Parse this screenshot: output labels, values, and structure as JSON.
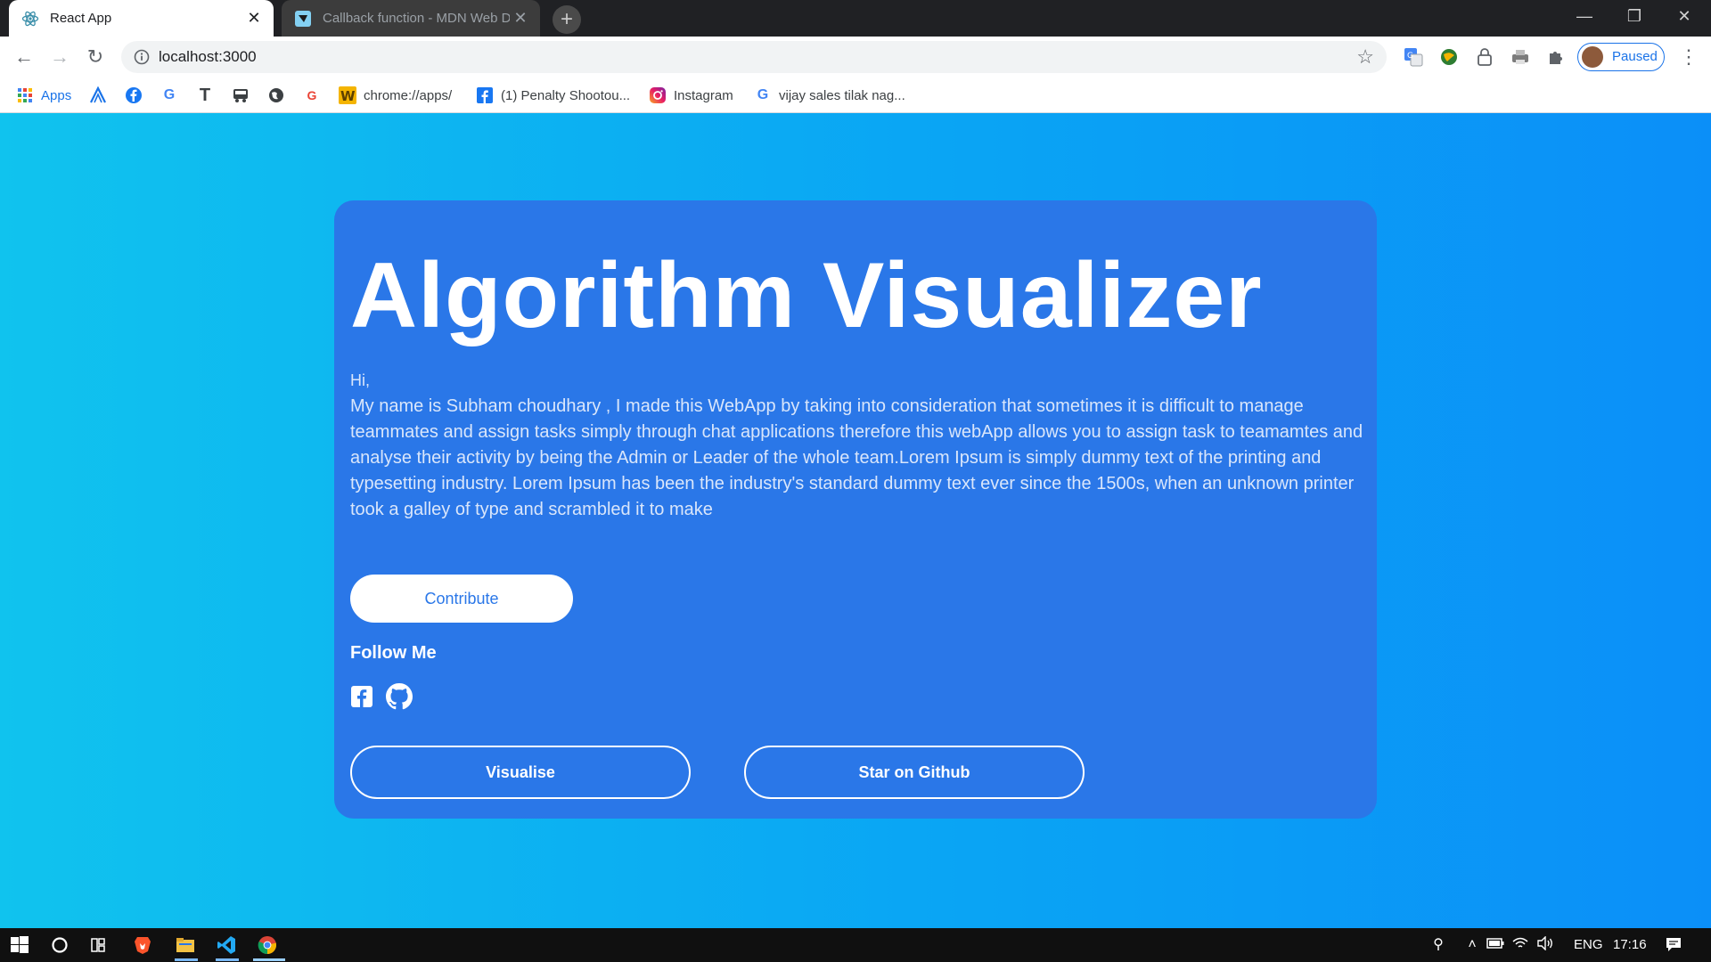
{
  "browser": {
    "tabs": [
      {
        "title": "React App",
        "favicon": "react-icon",
        "active": true
      },
      {
        "title": "Callback function - MDN Web Docs",
        "favicon": "mdn-icon",
        "active": false
      }
    ],
    "new_tab_label": "+",
    "window_controls": {
      "minimize": "—",
      "maximize": "❐",
      "close": "✕"
    },
    "address": "localhost:3000",
    "profile_label": "Paused",
    "extensions": [
      "translate-icon",
      "globe-extension-icon",
      "lock-extension-icon",
      "printer-icon",
      "puzzle-icon"
    ]
  },
  "bookmarks": [
    {
      "label": "Apps",
      "icon": "apps-grid-icon"
    },
    {
      "label": "",
      "icon": "a-logo-icon"
    },
    {
      "label": "",
      "icon": "facebook-icon"
    },
    {
      "label": "",
      "icon": "google-icon"
    },
    {
      "label": "",
      "icon": "tz-icon"
    },
    {
      "label": "",
      "icon": "bus-icon"
    },
    {
      "label": "",
      "icon": "globe-icon"
    },
    {
      "label": "",
      "icon": "google-small-icon"
    },
    {
      "label": "chrome://apps/",
      "icon": "w-icon"
    },
    {
      "label": "(1) Penalty Shootou...",
      "icon": "facebook-icon"
    },
    {
      "label": "Instagram",
      "icon": "instagram-icon"
    },
    {
      "label": "vijay sales tilak nag...",
      "icon": "google-icon"
    }
  ],
  "hero": {
    "title": "Algorithm Visualizer",
    "greeting": "Hi,",
    "bio": "My name is Subham choudhary , I made this WebApp by taking into consideration that sometimes it is difficult to manage teammates and assign tasks simply through chat applications therefore this webApp allows you to assign task to teamamtes and analyse their activity by being the Admin or Leader of the whole team.Lorem Ipsum is simply dummy text of the printing and typesetting industry. Lorem Ipsum has been the industry's standard dummy text ever since the 1500s, when an unknown printer took a galley of type and scrambled it to make",
    "contribute_label": "Contribute",
    "follow_heading": "Follow Me",
    "visualise_label": "Visualise",
    "star_label": "Star on Github"
  },
  "taskbar": {
    "apps": [
      "windows-start-icon",
      "cortana-icon",
      "task-view-icon",
      "brave-icon",
      "file-explorer-icon",
      "vscode-icon",
      "chrome-icon"
    ],
    "language": "ENG",
    "time": "17:16"
  },
  "colors": {
    "card": "#2a77e8",
    "page_gradient_start": "#10c3ee",
    "page_gradient_end": "#0b8ff8",
    "accent_blue": "#1a73e8"
  }
}
